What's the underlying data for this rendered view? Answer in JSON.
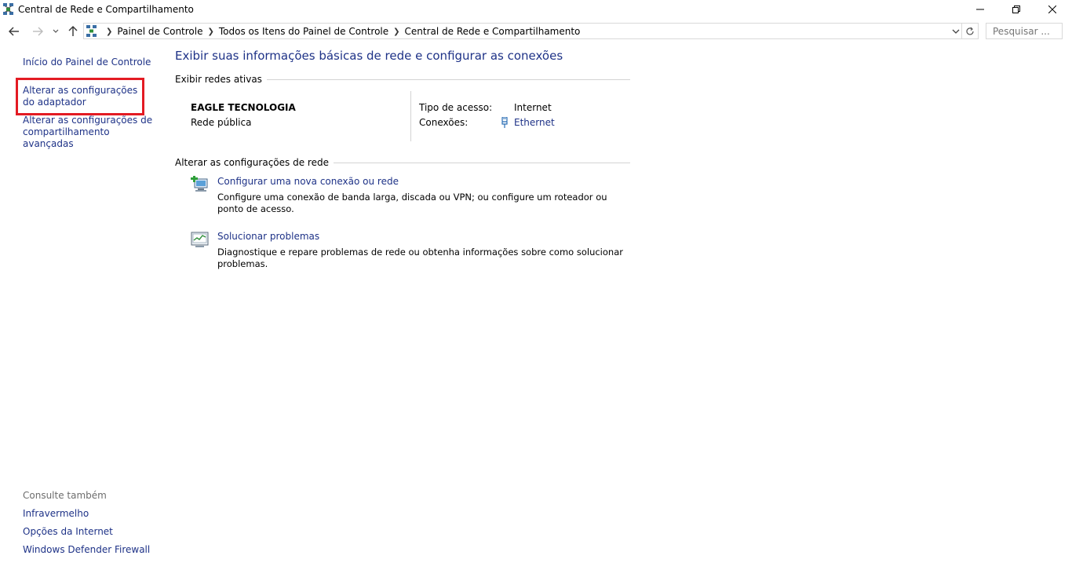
{
  "window": {
    "title": "Central de Rede e Compartilhamento"
  },
  "nav": {
    "breadcrumbs": [
      "Painel de Controle",
      "Todos os Itens do Painel de Controle",
      "Central de Rede e Compartilhamento"
    ],
    "search_placeholder": "Pesquisar ..."
  },
  "left_pane": {
    "home_link": "Início do Painel de Controle",
    "adapter_link": "Alterar as configurações do adaptador",
    "sharing_link": "Alterar as configurações de compartilhamento avançadas",
    "see_also_title": "Consulte também",
    "see_also": [
      "Infravermelho",
      "Opções da Internet",
      "Windows Defender Firewall"
    ]
  },
  "main": {
    "heading": "Exibir suas informações básicas de rede e configurar as conexões",
    "active_networks_title": "Exibir redes ativas",
    "network": {
      "name": "EAGLE TECNOLOGIA",
      "type": "Rede pública",
      "access_label": "Tipo de acesso:",
      "access_value": "Internet",
      "connections_label": "Conexões:",
      "connections_value": "Ethernet"
    },
    "change_settings_title": "Alterar as configurações de rede",
    "tasks": [
      {
        "title": "Configurar uma nova conexão ou rede",
        "description": "Configure uma conexão de banda larga, discada ou VPN; ou configure um roteador ou ponto de acesso."
      },
      {
        "title": "Solucionar problemas",
        "description": "Diagnostique e repare problemas de rede ou obtenha informações sobre como solucionar problemas."
      }
    ]
  },
  "colors": {
    "link": "#1e3287",
    "highlight": "#e31b23",
    "muted": "#6d6d6d"
  },
  "icons": {
    "app": "network-icon",
    "back": "back-arrow-icon",
    "forward": "forward-arrow-icon",
    "recent": "chevron-down-icon",
    "up": "up-arrow-icon",
    "refresh": "refresh-icon",
    "ethernet": "ethernet-plug-icon",
    "new_connection": "new-connection-icon",
    "troubleshoot": "troubleshoot-icon"
  }
}
